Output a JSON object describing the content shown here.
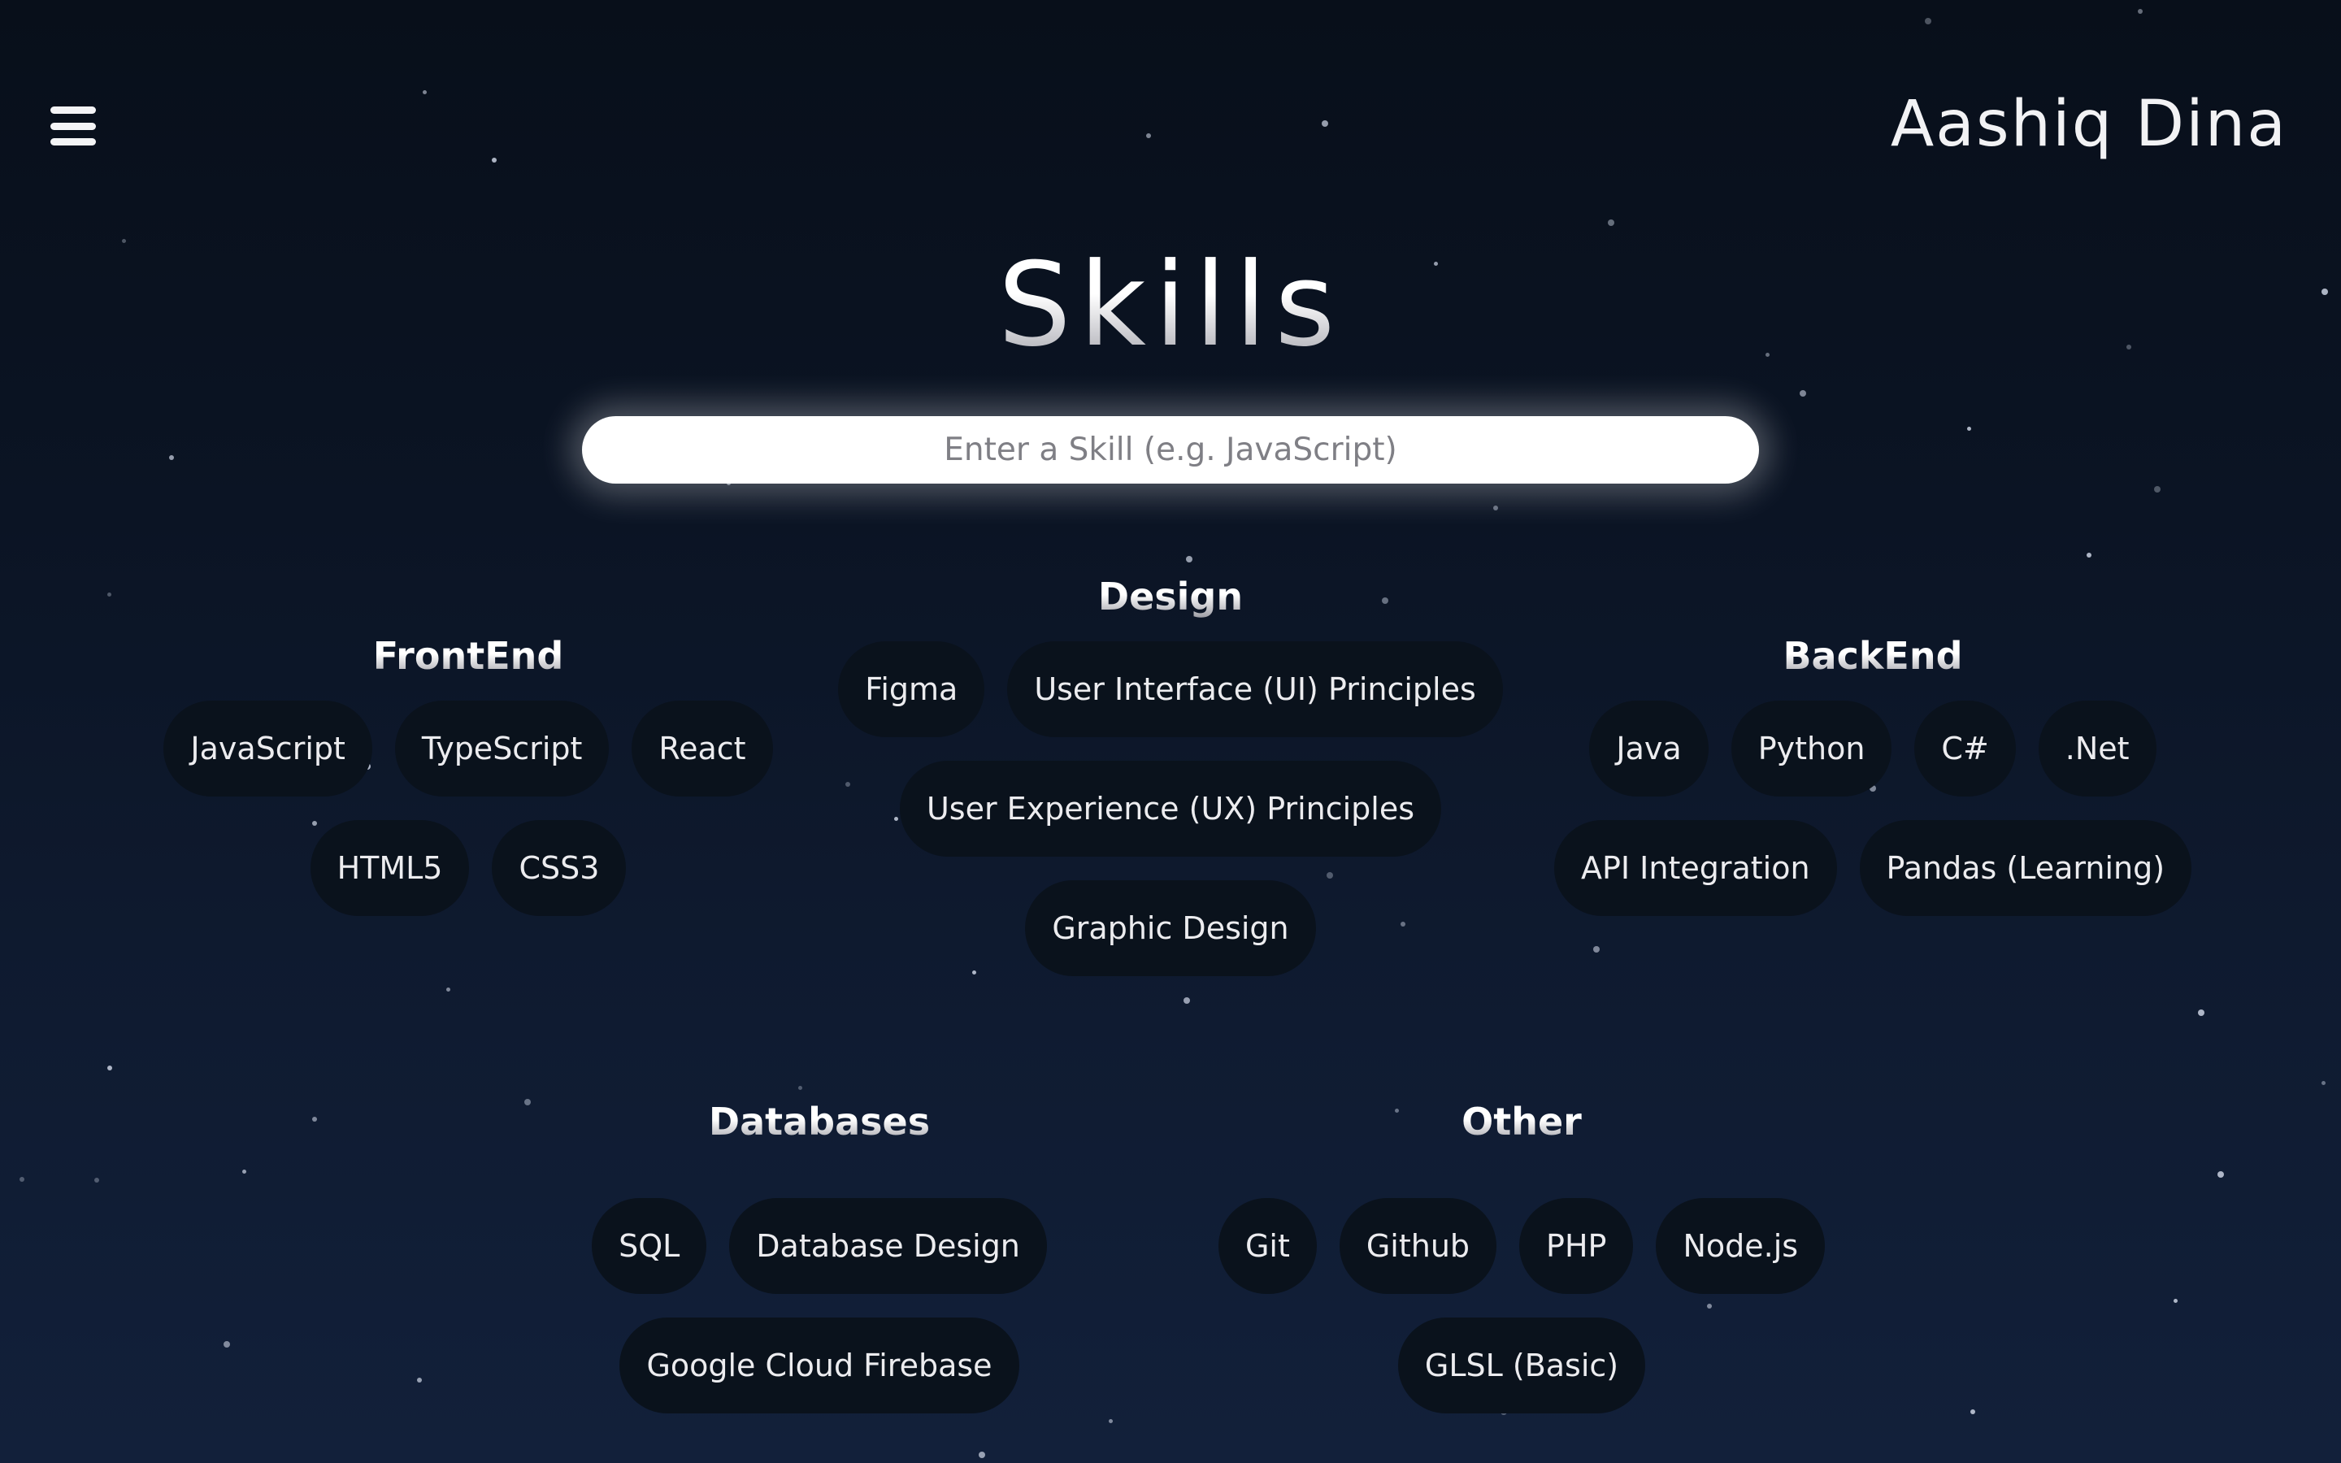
{
  "header": {
    "site_name": "Aashiq Dina"
  },
  "page": {
    "title": "Skills"
  },
  "search": {
    "placeholder": "Enter a Skill (e.g. JavaScript)",
    "value": ""
  },
  "categories": {
    "frontend": {
      "title": "FrontEnd",
      "skills": [
        "JavaScript",
        "TypeScript",
        "React",
        "HTML5",
        "CSS3"
      ]
    },
    "design": {
      "title": "Design",
      "skills": [
        "Figma",
        "User Interface (UI) Principles",
        "User Experience (UX) Principles",
        "Graphic Design"
      ]
    },
    "backend": {
      "title": "BackEnd",
      "skills": [
        "Java",
        "Python",
        "C#",
        ".Net",
        "API Integration",
        "Pandas (Learning)"
      ]
    },
    "databases": {
      "title": "Databases",
      "skills": [
        "SQL",
        "Database Design",
        "Google Cloud Firebase"
      ]
    },
    "other": {
      "title": "Other",
      "skills": [
        "Git",
        "Github",
        "PHP",
        "Node.js",
        "GLSL (Basic)"
      ]
    }
  },
  "icons": {
    "menu": "hamburger-menu-icon"
  },
  "colors": {
    "background_top": "#080f1a",
    "background_bottom": "#12203a",
    "pill_background": "#0a121c",
    "text": "#ececef"
  }
}
